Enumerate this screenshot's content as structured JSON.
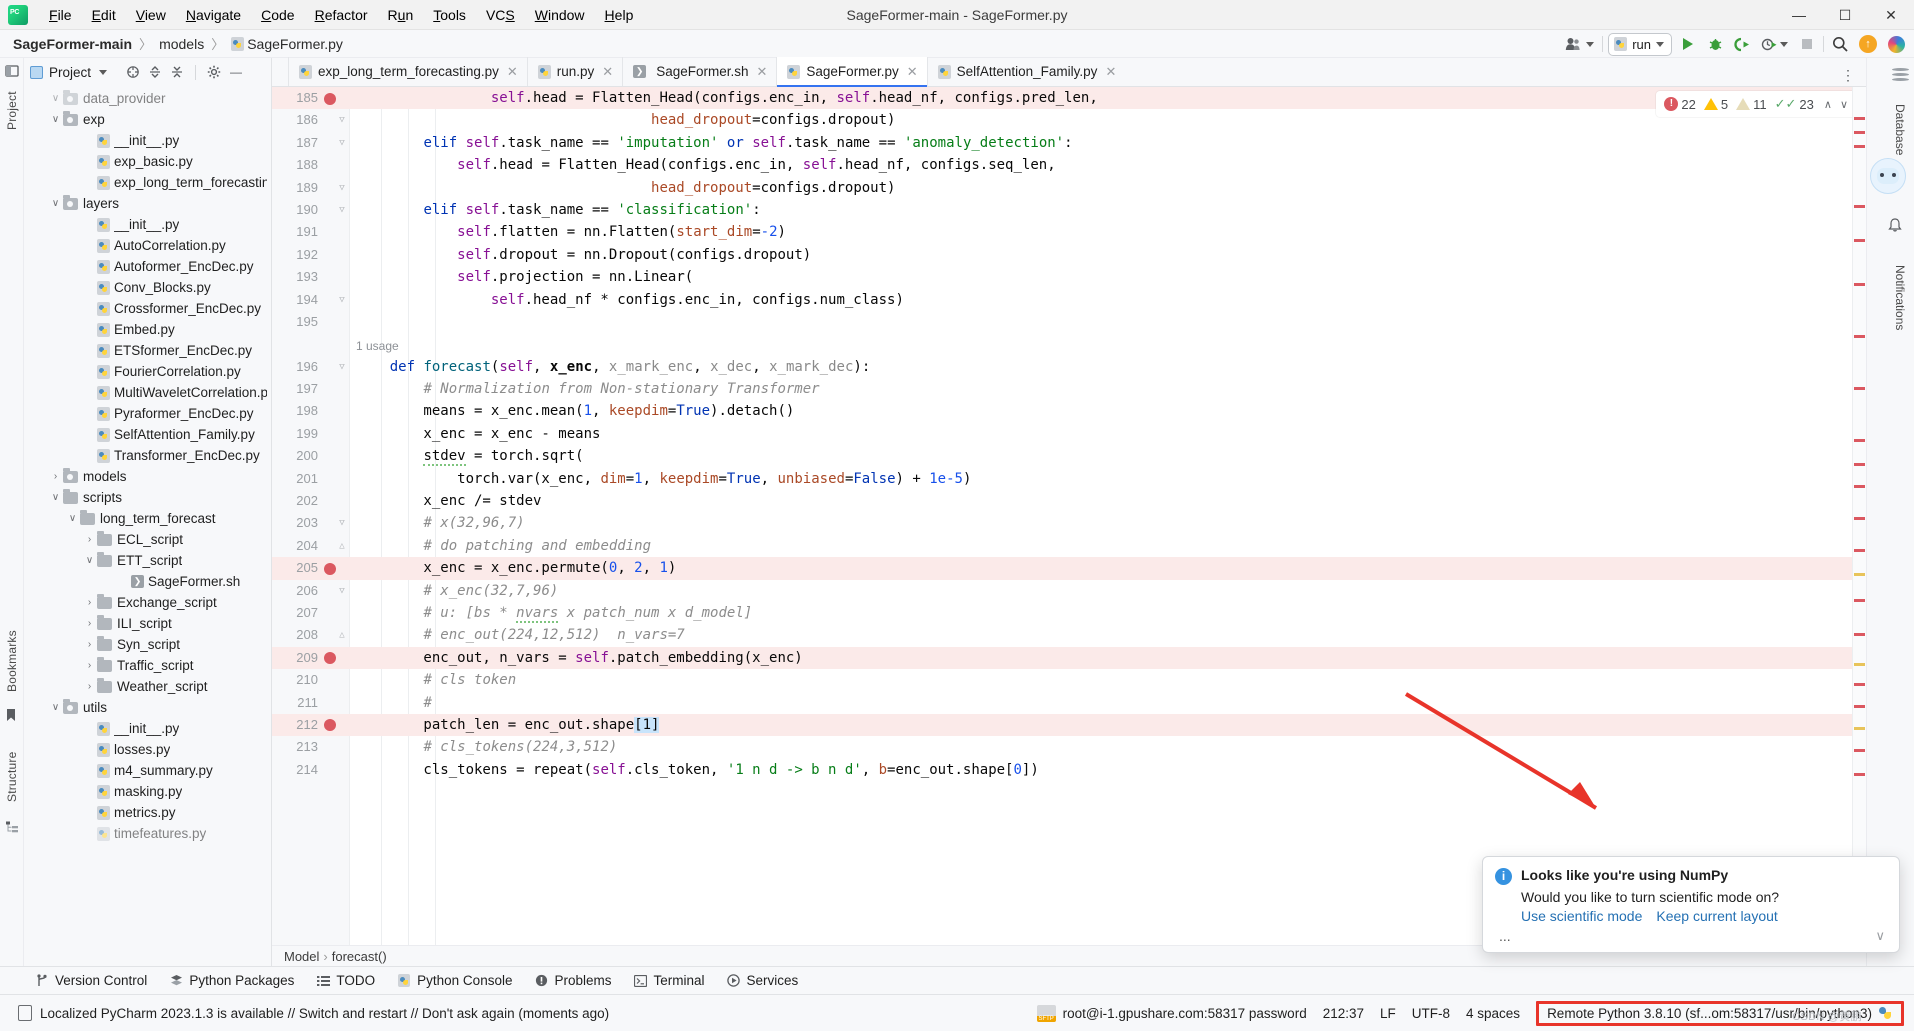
{
  "window": {
    "title": "SageFormer-main - SageFormer.py",
    "minimize": "—",
    "maximize": "☐",
    "close": "✕"
  },
  "menubar": {
    "items": [
      "File",
      "Edit",
      "View",
      "Navigate",
      "Code",
      "Refactor",
      "Run",
      "Tools",
      "VCS",
      "Window",
      "Help"
    ]
  },
  "breadcrumb": {
    "project": "SageFormer-main",
    "folder": "models",
    "file": "SageFormer.py",
    "separator": "〉"
  },
  "toolbar": {
    "run_config": "run",
    "run_tooltip": "Run",
    "debug_tooltip": "Debug",
    "coverage_tooltip": "Run with Coverage",
    "profile_tooltip": "Profile",
    "stop_tooltip": "Stop",
    "search_tooltip": "Search Everywhere",
    "update_tooltip": "Update",
    "ai_tooltip": "AI Assistant"
  },
  "project_panel": {
    "title": "Project",
    "tree": [
      {
        "label": "data_provider",
        "depth": 1,
        "type": "folder-module",
        "arrow": "⌄",
        "clipped": true
      },
      {
        "label": "exp",
        "depth": 1,
        "type": "folder-module",
        "arrow": "⌄"
      },
      {
        "label": "__init__.py",
        "depth": 3,
        "type": "py",
        "arrow": ""
      },
      {
        "label": "exp_basic.py",
        "depth": 3,
        "type": "py",
        "arrow": ""
      },
      {
        "label": "exp_long_term_forecasting.py",
        "depth": 3,
        "type": "py",
        "arrow": ""
      },
      {
        "label": "layers",
        "depth": 1,
        "type": "folder-module",
        "arrow": "⌄"
      },
      {
        "label": "__init__.py",
        "depth": 3,
        "type": "py",
        "arrow": ""
      },
      {
        "label": "AutoCorrelation.py",
        "depth": 3,
        "type": "py",
        "arrow": ""
      },
      {
        "label": "Autoformer_EncDec.py",
        "depth": 3,
        "type": "py",
        "arrow": ""
      },
      {
        "label": "Conv_Blocks.py",
        "depth": 3,
        "type": "py",
        "arrow": ""
      },
      {
        "label": "Crossformer_EncDec.py",
        "depth": 3,
        "type": "py",
        "arrow": ""
      },
      {
        "label": "Embed.py",
        "depth": 3,
        "type": "py",
        "arrow": ""
      },
      {
        "label": "ETSformer_EncDec.py",
        "depth": 3,
        "type": "py",
        "arrow": ""
      },
      {
        "label": "FourierCorrelation.py",
        "depth": 3,
        "type": "py",
        "arrow": ""
      },
      {
        "label": "MultiWaveletCorrelation.py",
        "depth": 3,
        "type": "py",
        "arrow": ""
      },
      {
        "label": "Pyraformer_EncDec.py",
        "depth": 3,
        "type": "py",
        "arrow": ""
      },
      {
        "label": "SelfAttention_Family.py",
        "depth": 3,
        "type": "py",
        "arrow": ""
      },
      {
        "label": "Transformer_EncDec.py",
        "depth": 3,
        "type": "py",
        "arrow": ""
      },
      {
        "label": "models",
        "depth": 1,
        "type": "folder-module",
        "arrow": "›"
      },
      {
        "label": "scripts",
        "depth": 1,
        "type": "folder",
        "arrow": "⌄"
      },
      {
        "label": "long_term_forecast",
        "depth": 2,
        "type": "folder",
        "arrow": "⌄"
      },
      {
        "label": "ECL_script",
        "depth": 3,
        "type": "folder",
        "arrow": "›"
      },
      {
        "label": "ETT_script",
        "depth": 3,
        "type": "folder",
        "arrow": "⌄"
      },
      {
        "label": "SageFormer.sh",
        "depth": 5,
        "type": "sh",
        "arrow": ""
      },
      {
        "label": "Exchange_script",
        "depth": 3,
        "type": "folder",
        "arrow": "›"
      },
      {
        "label": "ILI_script",
        "depth": 3,
        "type": "folder",
        "arrow": "›"
      },
      {
        "label": "Syn_script",
        "depth": 3,
        "type": "folder",
        "arrow": "›"
      },
      {
        "label": "Traffic_script",
        "depth": 3,
        "type": "folder",
        "arrow": "›"
      },
      {
        "label": "Weather_script",
        "depth": 3,
        "type": "folder",
        "arrow": "›"
      },
      {
        "label": "utils",
        "depth": 1,
        "type": "folder-module",
        "arrow": "⌄"
      },
      {
        "label": "__init__.py",
        "depth": 3,
        "type": "py",
        "arrow": ""
      },
      {
        "label": "losses.py",
        "depth": 3,
        "type": "py",
        "arrow": ""
      },
      {
        "label": "m4_summary.py",
        "depth": 3,
        "type": "py",
        "arrow": ""
      },
      {
        "label": "masking.py",
        "depth": 3,
        "type": "py",
        "arrow": ""
      },
      {
        "label": "metrics.py",
        "depth": 3,
        "type": "py",
        "arrow": ""
      },
      {
        "label": "timefeatures.py",
        "depth": 3,
        "type": "py",
        "arrow": "",
        "clipped": true
      }
    ]
  },
  "left_strip": {
    "project_label": "Project",
    "bookmarks_label": "Bookmarks",
    "structure_label": "Structure"
  },
  "right_strip": {
    "database_label": "Database",
    "notifications_label": "Notifications"
  },
  "tabs": [
    {
      "label": "exp_long_term_forecasting.py",
      "icon": "python-file-icon",
      "active": false
    },
    {
      "label": "run.py",
      "icon": "python-file-icon",
      "active": false
    },
    {
      "label": "SageFormer.sh",
      "icon": "shell-file-icon",
      "active": false
    },
    {
      "label": "SageFormer.py",
      "icon": "python-file-icon",
      "active": true
    },
    {
      "label": "SelfAttention_Family.py",
      "icon": "python-file-icon",
      "active": false
    }
  ],
  "inspection": {
    "errors": "22",
    "warnings": "5",
    "weak_warnings": "11",
    "checks": "23",
    "prev": "∧",
    "next": "∨"
  },
  "editor": {
    "usage_label": "1 usage",
    "lines": [
      {
        "no": "185",
        "bp": true,
        "hl": true,
        "fold": "",
        "html": "                <span class=\"se\">self</span>.head = <span class=\"id\">Flatten_Head</span>(configs.enc_in, <span class=\"se\">self</span>.head_nf, configs.pred_len,"
      },
      {
        "no": "186",
        "bp": false,
        "hl": false,
        "fold": "▽",
        "html": "                                   <span class=\"pa\">head_dropout</span>=configs.dropout)"
      },
      {
        "no": "187",
        "bp": false,
        "hl": false,
        "fold": "▽",
        "html": "        <span class=\"k\">elif</span> <span class=\"se\">self</span>.task_name == <span class=\"s\">'imputation'</span> <span class=\"k\">or</span> <span class=\"se\">self</span>.task_name == <span class=\"s\">'anomaly_detection'</span>:"
      },
      {
        "no": "188",
        "bp": false,
        "hl": false,
        "fold": "",
        "html": "            <span class=\"se\">self</span>.head = <span class=\"id\">Flatten_Head</span>(configs.enc_in, <span class=\"se\">self</span>.head_nf, configs.seq_len,"
      },
      {
        "no": "189",
        "bp": false,
        "hl": false,
        "fold": "▽",
        "html": "                                   <span class=\"pa\">head_dropout</span>=configs.dropout)"
      },
      {
        "no": "190",
        "bp": false,
        "hl": false,
        "fold": "▽",
        "html": "        <span class=\"k\">elif</span> <span class=\"se\">self</span>.task_name == <span class=\"s\">'classification'</span>:"
      },
      {
        "no": "191",
        "bp": false,
        "hl": false,
        "fold": "",
        "html": "            <span class=\"se\">self</span>.flatten = nn.<span class=\"id\">Flatten</span>(<span class=\"pa\">start_dim</span>=<span class=\"n\">-2</span>)"
      },
      {
        "no": "192",
        "bp": false,
        "hl": false,
        "fold": "",
        "html": "            <span class=\"se\">self</span>.dropout = nn.<span class=\"id\">Dropout</span>(configs.dropout)"
      },
      {
        "no": "193",
        "bp": false,
        "hl": false,
        "fold": "",
        "html": "            <span class=\"se\">self</span>.projection = nn.<span class=\"id\">Linear</span>("
      },
      {
        "no": "194",
        "bp": false,
        "hl": false,
        "fold": "▽",
        "html": "                <span class=\"se\">self</span>.head_nf * configs.enc_in, configs.num_class)"
      },
      {
        "no": "195",
        "bp": false,
        "hl": false,
        "fold": "",
        "html": ""
      },
      {
        "no": "usage",
        "bp": false,
        "hl": false,
        "fold": "",
        "html": "1 usage"
      },
      {
        "no": "196",
        "bp": false,
        "hl": false,
        "fold": "▽",
        "html": "    <span class=\"k\">def</span> <span class=\"fn\">forecast</span>(<span class=\"se\">self</span>, <span class=\"bld\">x_enc</span>, <span class=\"pm\">x_mark_enc</span>, <span class=\"pm\">x_dec</span>, <span class=\"pm\">x_mark_dec</span>):"
      },
      {
        "no": "197",
        "bp": false,
        "hl": false,
        "fold": "",
        "html": "        <span class=\"c\"># Normalization from Non-stationary Transformer</span>"
      },
      {
        "no": "198",
        "bp": false,
        "hl": false,
        "fold": "",
        "html": "        means = x_enc.mean(<span class=\"n\">1</span>, <span class=\"pa\">keepdim</span>=<span class=\"k\">True</span>).detach()"
      },
      {
        "no": "199",
        "bp": false,
        "hl": false,
        "fold": "",
        "html": "        x_enc = x_enc - means"
      },
      {
        "no": "200",
        "bp": false,
        "hl": false,
        "fold": "",
        "html": "        <span class=\"squig\">stdev</span> = torch.sqrt("
      },
      {
        "no": "201",
        "bp": false,
        "hl": false,
        "fold": "",
        "html": "            torch.var(x_enc, <span class=\"pa\">dim</span>=<span class=\"n\">1</span>, <span class=\"pa\">keepdim</span>=<span class=\"k\">True</span>, <span class=\"pa\">unbiased</span>=<span class=\"k\">False</span>) + <span class=\"n\">1e-5</span>)"
      },
      {
        "no": "202",
        "bp": false,
        "hl": false,
        "fold": "",
        "html": "        x_enc /= stdev"
      },
      {
        "no": "203",
        "bp": false,
        "hl": false,
        "fold": "▽",
        "html": "        <span class=\"c\"># x(32,96,7)</span>"
      },
      {
        "no": "204",
        "bp": false,
        "hl": false,
        "fold": "△",
        "html": "        <span class=\"c\"># do patching and embedding</span>"
      },
      {
        "no": "205",
        "bp": true,
        "hl": true,
        "fold": "",
        "html": "        x_enc = x_enc.permute(<span class=\"n\">0</span>, <span class=\"n\">2</span>, <span class=\"n\">1</span>)"
      },
      {
        "no": "206",
        "bp": false,
        "hl": false,
        "fold": "▽",
        "html": "        <span class=\"c\"># x_enc(32,7,96)</span>"
      },
      {
        "no": "207",
        "bp": false,
        "hl": false,
        "fold": "",
        "html": "        <span class=\"c\"># u: [bs * <span class=\"squig\">nvars</span> x patch_num x d_model]</span>"
      },
      {
        "no": "208",
        "bp": false,
        "hl": false,
        "fold": "△",
        "html": "        <span class=\"c\"># enc_out(224,12,512)  n_vars=7</span>"
      },
      {
        "no": "209",
        "bp": true,
        "hl": true,
        "fold": "",
        "html": "        enc_out, n_vars = <span class=\"se\">self</span>.patch_embedding(x_enc)"
      },
      {
        "no": "210",
        "bp": false,
        "hl": false,
        "fold": "",
        "html": "        <span class=\"c\"># cls token</span>"
      },
      {
        "no": "211",
        "bp": false,
        "hl": false,
        "fold": "",
        "html": "        <span class=\"c\">#</span>"
      },
      {
        "no": "212",
        "bp": true,
        "hl": true,
        "fold": "",
        "html": "        patch_len = enc_out.shape<span class=\"selbox\">[1]</span>"
      },
      {
        "no": "213",
        "bp": false,
        "hl": false,
        "fold": "",
        "html": "        <span class=\"c\"># cls_tokens(224,3,512)</span>"
      },
      {
        "no": "214",
        "bp": false,
        "hl": false,
        "fold": "",
        "html": "        cls_tokens = repeat(<span class=\"se\">self</span>.cls_token, <span class=\"s\">'1 n d -> b n d'</span>, <span class=\"pa\">b</span>=enc_out.shape[<span class=\"n\">0</span>])"
      }
    ]
  },
  "editor_breadcrumb": {
    "class": "Model",
    "method": "forecast()",
    "separator": "›"
  },
  "notification": {
    "title": "Looks like you're using NumPy",
    "subtitle": "Would you like to turn scientific mode on?",
    "link_primary": "Use scientific mode",
    "link_secondary": "Keep current layout",
    "more": "...",
    "collapse": "∨"
  },
  "bottom_bar": {
    "items": [
      {
        "label": "Version Control",
        "icon": "branch-icon"
      },
      {
        "label": "Python Packages",
        "icon": "packages-icon"
      },
      {
        "label": "TODO",
        "icon": "todo-icon"
      },
      {
        "label": "Python Console",
        "icon": "python-console-icon"
      },
      {
        "label": "Problems",
        "icon": "problems-icon"
      },
      {
        "label": "Terminal",
        "icon": "terminal-icon"
      },
      {
        "label": "Services",
        "icon": "services-icon"
      }
    ]
  },
  "status_bar": {
    "message": "Localized PyCharm 2023.1.3 is available // Switch and restart // Don't ask again (moments ago)",
    "sftp": "root@i-1.gpushare.com:58317 password",
    "caret": "212:37",
    "line_ending": "LF",
    "encoding": "UTF-8",
    "indent": "4 spaces",
    "interpreter": "Remote Python 3.8.10 (sf...om:58317/usr/bin/python3)",
    "watermark": "CSDN @黄鹏"
  },
  "colors": {
    "accent": "#3573f0",
    "error": "#db5860",
    "warning": "#ffc107",
    "ok": "#59a869",
    "highlight_line": "#fbeae9",
    "link": "#2470b3",
    "redbox": "#e8342a"
  }
}
